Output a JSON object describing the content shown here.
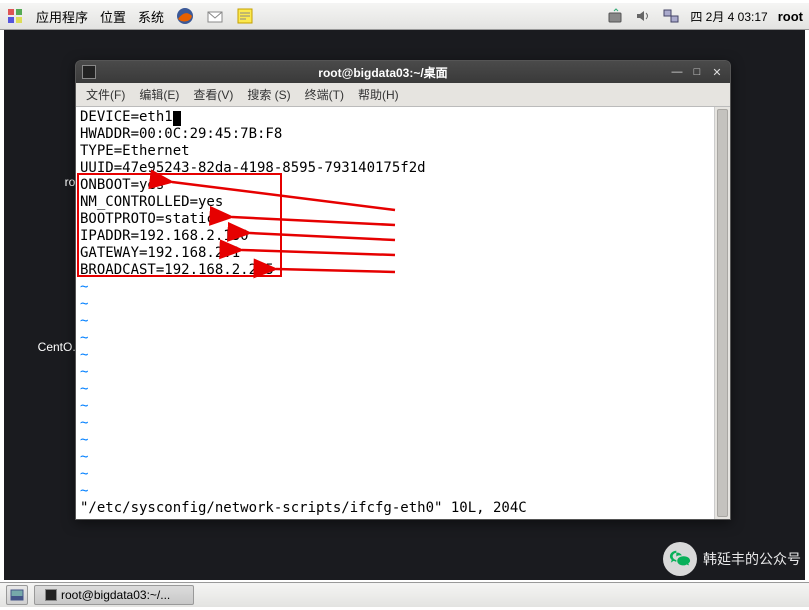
{
  "top_panel": {
    "apps": "应用程序",
    "places": "位置",
    "system": "系统",
    "clock": "四 2月  4 03:17",
    "user": "root"
  },
  "bottom_panel": {
    "task_title": "root@bigdata03:~/..."
  },
  "desktop_icons": {
    "home": "root...",
    "centos": "CentO..."
  },
  "window": {
    "title": "root@bigdata03:~/桌面",
    "menu": {
      "file": "文件(F)",
      "edit": "编辑(E)",
      "view": "查看(V)",
      "search": "搜索 (S)",
      "terminal": "终端(T)",
      "help": "帮助(H)"
    }
  },
  "terminal": {
    "lines": [
      "DEVICE=eth1",
      "HWADDR=00:0C:29:45:7B:F8",
      "TYPE=Ethernet",
      "UUID=47e95243-82da-4198-8595-793140175f2d",
      "ONBOOT=yes",
      "NM_CONTROLLED=yes",
      "BOOTPROTO=static",
      "IPADDR=192.168.2.130",
      "GATEWAY=192.168.2.1",
      "BROADCAST=192.168.2.255"
    ],
    "status": "\"/etc/sysconfig/network-scripts/ifcfg-eth0\" 10L, 204C"
  },
  "watermark": {
    "text": "韩延丰的公众号"
  }
}
